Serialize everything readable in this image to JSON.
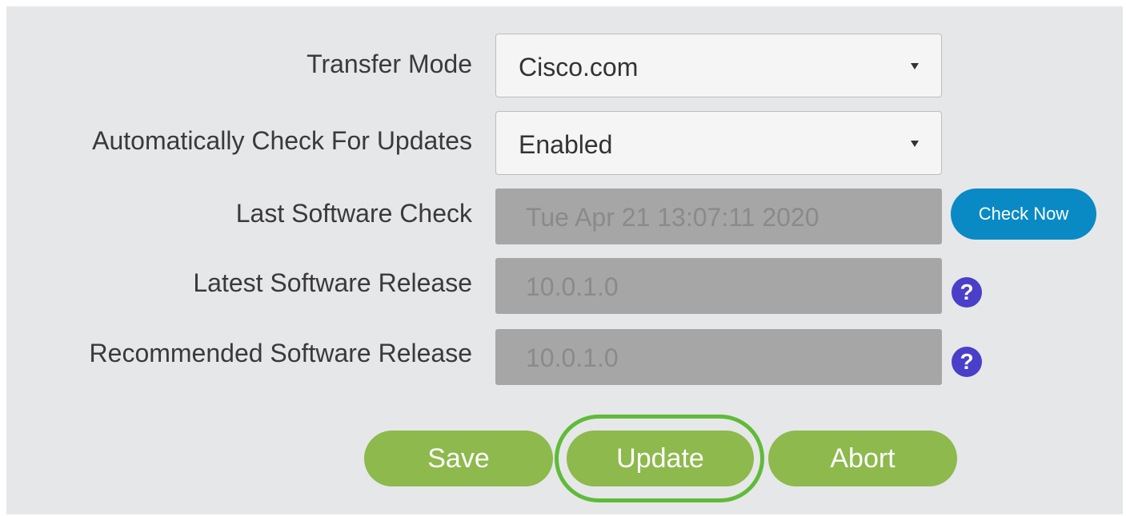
{
  "form": {
    "transfer_mode": {
      "label": "Transfer Mode",
      "value": "Cisco.com"
    },
    "auto_check": {
      "label": "Automatically Check For Updates",
      "value": "Enabled"
    },
    "last_check": {
      "label": "Last Software Check",
      "value": "Tue Apr 21 13:07:11 2020",
      "button_label": "Check Now"
    },
    "latest_release": {
      "label": "Latest Software Release",
      "value": "10.0.1.0",
      "help_glyph": "?"
    },
    "recommended_release": {
      "label": "Recommended Software Release",
      "value": "10.0.1.0",
      "help_glyph": "?"
    }
  },
  "actions": {
    "save_label": "Save",
    "update_label": "Update",
    "abort_label": "Abort"
  },
  "colors": {
    "panel_bg": "#e6e7e8",
    "action_green": "#8db94d",
    "highlight_green": "#5fbb38",
    "check_now_blue": "#0a8ac4",
    "help_purple": "#4a3fc8",
    "readonly_gray": "#a6a6a6"
  },
  "icons": {
    "help": "question-circle-icon",
    "dropdown": "caret-down-icon"
  }
}
